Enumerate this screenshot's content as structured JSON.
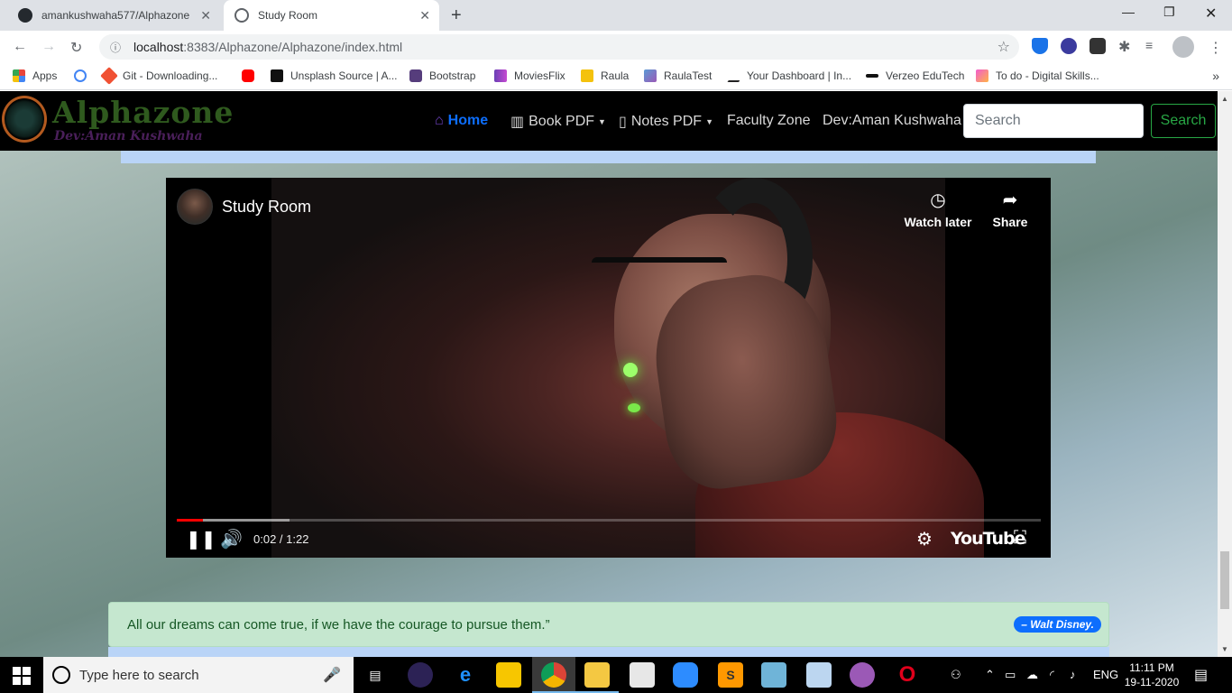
{
  "browser": {
    "tabs": [
      {
        "title": "amankushwaha577/Alphazone",
        "active": false
      },
      {
        "title": "Study Room",
        "active": true
      }
    ],
    "url_host": "localhost",
    "url_rest": ":8383/Alphazone/Alphazone/index.html",
    "bookmarks": [
      {
        "label": "Apps",
        "color": "#e8453c"
      },
      {
        "label": "",
        "color": "#4285f4"
      },
      {
        "label": "Git - Downloading...",
        "color": "#f05133"
      },
      {
        "label": "",
        "color": "#ff0000"
      },
      {
        "label": "Unsplash Source | A...",
        "color": "#111111"
      },
      {
        "label": "Bootstrap",
        "color": "#563d7c"
      },
      {
        "label": "MoviesFlix",
        "color": "#6a3fb5"
      },
      {
        "label": "Raula",
        "color": "#f4c20d"
      },
      {
        "label": "RaulaTest",
        "color": "#5b9bd5"
      },
      {
        "label": "Your Dashboard | In...",
        "color": "#222222"
      },
      {
        "label": "Verzeo EduTech",
        "color": "#111111"
      },
      {
        "label": "To do - Digital Skills...",
        "color": "#f25ccf"
      }
    ],
    "bookmarks_more": "»"
  },
  "site": {
    "logo_title": "Alphazone",
    "logo_sub": "Dev:Aman Kushwaha",
    "nav": {
      "home": "Home",
      "book_pdf": "Book PDF",
      "notes_pdf": "Notes PDF",
      "faculty": "Faculty Zone",
      "dev": "Dev:Aman Kushwaha"
    },
    "search_placeholder": "Search",
    "search_button": "Search"
  },
  "video": {
    "channel_title": "Study Room",
    "watch_later": "Watch later",
    "share": "Share",
    "time": "0:02 / 1:22",
    "played_fraction": 0.03,
    "buffered_fraction": 0.13,
    "brand": "YouTube"
  },
  "quote": {
    "text": "All our dreams can come true, if we have the courage to pursue them.”",
    "author": "– Walt Disney."
  },
  "taskbar": {
    "search_placeholder": "Type here to search",
    "lang": "ENG",
    "time": "11:11 PM",
    "date": "19-11-2020"
  }
}
